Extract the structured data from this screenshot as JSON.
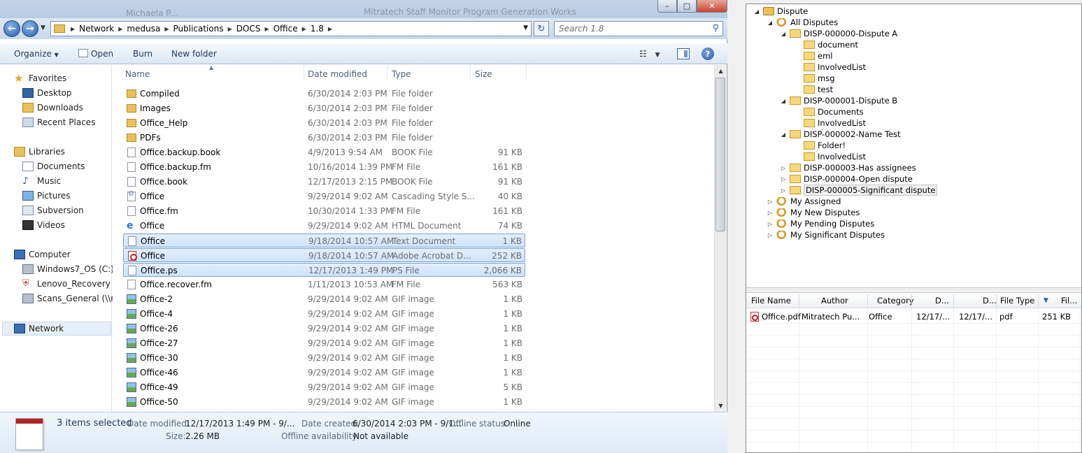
{
  "explorer": {
    "title_bg_texts": [
      "Michaela P...",
      "Mitratech Staff Monitor Program Generation Works"
    ],
    "caption_buttons": [
      "–",
      "□",
      "✕"
    ],
    "breadcrumbs": [
      "Network",
      "medusa",
      "Publications",
      "DOCS",
      "Office",
      "1.8"
    ],
    "search_placeholder": "Search 1.8",
    "commands": {
      "organize": "Organize",
      "open": "Open",
      "burn": "Burn",
      "new_folder": "New folder"
    },
    "nav": {
      "favorites": "Favorites",
      "desktop": "Desktop",
      "downloads": "Downloads",
      "recent_places": "Recent Places",
      "libraries": "Libraries",
      "documents": "Documents",
      "music": "Music",
      "pictures": "Pictures",
      "subversion": "Subversion",
      "videos": "Videos",
      "computer": "Computer",
      "windows7_os": "Windows7_OS (C:)",
      "lenovo_recovery": "Lenovo_Recovery (Q",
      "scans_general": "Scans_General (\\\\mt",
      "network": "Network"
    },
    "columns": {
      "name": "Name",
      "date_modified": "Date modified",
      "type": "Type",
      "size": "Size"
    },
    "files": [
      {
        "name": "Compiled",
        "date": "6/30/2014 2:03 PM",
        "type": "File folder",
        "size": "",
        "icon": "folder-icon",
        "selected": false
      },
      {
        "name": "Images",
        "date": "6/30/2014 2:03 PM",
        "type": "File folder",
        "size": "",
        "icon": "folder-icon",
        "selected": false
      },
      {
        "name": "Office_Help",
        "date": "6/30/2014 2:03 PM",
        "type": "File folder",
        "size": "",
        "icon": "folder-icon",
        "selected": false
      },
      {
        "name": "PDFs",
        "date": "6/30/2014 2:03 PM",
        "type": "File folder",
        "size": "",
        "icon": "folder-icon",
        "selected": false
      },
      {
        "name": "Office.backup.book",
        "date": "4/9/2013 9:54 AM",
        "type": "BOOK File",
        "size": "91 KB",
        "icon": "document-icon",
        "selected": false
      },
      {
        "name": "Office.backup.fm",
        "date": "10/16/2014 1:39 PM",
        "type": "FM File",
        "size": "161 KB",
        "icon": "document-icon",
        "selected": false
      },
      {
        "name": "Office.book",
        "date": "12/17/2013 2:15 PM",
        "type": "BOOK File",
        "size": "91 KB",
        "icon": "document-icon",
        "selected": false
      },
      {
        "name": "Office",
        "date": "9/29/2014 9:02 AM",
        "type": "Cascading Style S...",
        "size": "40 KB",
        "icon": "css-file-icon",
        "selected": false
      },
      {
        "name": "Office.fm",
        "date": "10/30/2014 1:33 PM",
        "type": "FM File",
        "size": "161 KB",
        "icon": "document-icon",
        "selected": false
      },
      {
        "name": "Office",
        "date": "9/29/2014 9:02 AM",
        "type": "HTML Document",
        "size": "74 KB",
        "icon": "html-file-icon",
        "selected": false
      },
      {
        "name": "Office",
        "date": "9/18/2014 10:57 AM",
        "type": "Text Document",
        "size": "1 KB",
        "icon": "document-icon",
        "selected": true
      },
      {
        "name": "Office",
        "date": "9/18/2014 10:57 AM",
        "type": "Adobe Acrobat D...",
        "size": "252 KB",
        "icon": "pdf-file-icon",
        "selected": true
      },
      {
        "name": "Office.ps",
        "date": "12/17/2013 1:49 PM",
        "type": "PS File",
        "size": "2,066 KB",
        "icon": "document-icon",
        "selected": true
      },
      {
        "name": "Office.recover.fm",
        "date": "1/11/2013 10:53 AM",
        "type": "FM File",
        "size": "563 KB",
        "icon": "document-icon",
        "selected": false
      },
      {
        "name": "Office-2",
        "date": "9/29/2014 9:02 AM",
        "type": "GIF image",
        "size": "1 KB",
        "icon": "gif-image-icon",
        "selected": false
      },
      {
        "name": "Office-4",
        "date": "9/29/2014 9:02 AM",
        "type": "GIF image",
        "size": "1 KB",
        "icon": "gif-image-icon",
        "selected": false
      },
      {
        "name": "Office-26",
        "date": "9/29/2014 9:02 AM",
        "type": "GIF image",
        "size": "1 KB",
        "icon": "gif-image-icon",
        "selected": false
      },
      {
        "name": "Office-27",
        "date": "9/29/2014 9:02 AM",
        "type": "GIF image",
        "size": "1 KB",
        "icon": "gif-image-icon",
        "selected": false
      },
      {
        "name": "Office-30",
        "date": "9/29/2014 9:02 AM",
        "type": "GIF image",
        "size": "1 KB",
        "icon": "gif-image-icon",
        "selected": false
      },
      {
        "name": "Office-46",
        "date": "9/29/2014 9:02 AM",
        "type": "GIF image",
        "size": "1 KB",
        "icon": "gif-image-icon",
        "selected": false
      },
      {
        "name": "Office-49",
        "date": "9/29/2014 9:02 AM",
        "type": "GIF image",
        "size": "5 KB",
        "icon": "gif-image-icon",
        "selected": false
      },
      {
        "name": "Office-50",
        "date": "9/29/2014 9:02 AM",
        "type": "GIF image",
        "size": "1 KB",
        "icon": "gif-image-icon",
        "selected": false
      }
    ],
    "details": {
      "selected_count": "3 items selected",
      "date_modified_label": "Date modified:",
      "date_modified_value": "12/17/2013 1:49 PM - 9/...",
      "date_created_label": "Date created:",
      "date_created_value": "6/30/2014 2:03 PM - 9/1...",
      "offline_status_label": "Offline status:",
      "offline_status_value": "Online",
      "size_label": "Size:",
      "size_value": "2.26 MB",
      "offline_availability_label": "Offline availability:",
      "offline_availability_value": "Not available"
    }
  },
  "dispute_app": {
    "tree": [
      {
        "label": "Dispute",
        "icon": "dispute-icon",
        "expander": "◢",
        "level": 0,
        "highlight": false
      },
      {
        "label": "All Disputes",
        "icon": "search-folder-icon",
        "expander": "◢",
        "level": 1,
        "highlight": false
      },
      {
        "label": "DISP-000000-Dispute A",
        "icon": "folder-icon",
        "expander": "◢",
        "level": 2,
        "highlight": false
      },
      {
        "label": "document",
        "icon": "folder-icon",
        "expander": "",
        "level": 3,
        "highlight": false
      },
      {
        "label": "eml",
        "icon": "folder-icon",
        "expander": "",
        "level": 3,
        "highlight": false
      },
      {
        "label": "InvolvedList",
        "icon": "folder-icon",
        "expander": "",
        "level": 3,
        "highlight": false
      },
      {
        "label": "msg",
        "icon": "folder-icon",
        "expander": "",
        "level": 3,
        "highlight": false
      },
      {
        "label": "test",
        "icon": "folder-icon",
        "expander": "",
        "level": 3,
        "highlight": false
      },
      {
        "label": "DISP-000001-Dispute B",
        "icon": "folder-icon",
        "expander": "◢",
        "level": 2,
        "highlight": false
      },
      {
        "label": "Documents",
        "icon": "folder-icon",
        "expander": "",
        "level": 3,
        "highlight": false
      },
      {
        "label": "InvolvedList",
        "icon": "folder-icon",
        "expander": "",
        "level": 3,
        "highlight": false
      },
      {
        "label": "DISP-000002-Name Test",
        "icon": "folder-icon",
        "expander": "◢",
        "level": 2,
        "highlight": false
      },
      {
        "label": "Folder!",
        "icon": "folder-icon",
        "expander": "",
        "level": 3,
        "highlight": false
      },
      {
        "label": "InvolvedList",
        "icon": "folder-icon",
        "expander": "",
        "level": 3,
        "highlight": false
      },
      {
        "label": "DISP-000003-Has assignees",
        "icon": "folder-icon",
        "expander": "▷",
        "level": 2,
        "highlight": false
      },
      {
        "label": "DISP-000004-Open dispute",
        "icon": "folder-icon",
        "expander": "▷",
        "level": 2,
        "highlight": false
      },
      {
        "label": "DISP-000005-Significant dispute",
        "icon": "folder-icon",
        "expander": "▷",
        "level": 2,
        "highlight": true
      },
      {
        "label": "My Assigned",
        "icon": "search-folder-icon",
        "expander": "▷",
        "level": 1,
        "highlight": false
      },
      {
        "label": "My New Disputes",
        "icon": "search-folder-icon",
        "expander": "▷",
        "level": 1,
        "highlight": false
      },
      {
        "label": "My Pending Disputes",
        "icon": "search-folder-icon",
        "expander": "▷",
        "level": 1,
        "highlight": false
      },
      {
        "label": "My Significant Disputes",
        "icon": "search-folder-icon",
        "expander": "▷",
        "level": 1,
        "highlight": false
      }
    ],
    "grid": {
      "headers": {
        "file_name": "File Name",
        "author": "Author",
        "category": "Category",
        "d1": "D...",
        "d2": "D...",
        "file_type": "File Type",
        "file_size": "Fil..."
      },
      "row": {
        "file_name": "Office.pdf",
        "author": "Mitratech Pu...",
        "category": "Office",
        "d1": "12/17/...",
        "d2": "12/17/...",
        "file_type": "pdf",
        "file_size": "251 KB"
      }
    }
  }
}
